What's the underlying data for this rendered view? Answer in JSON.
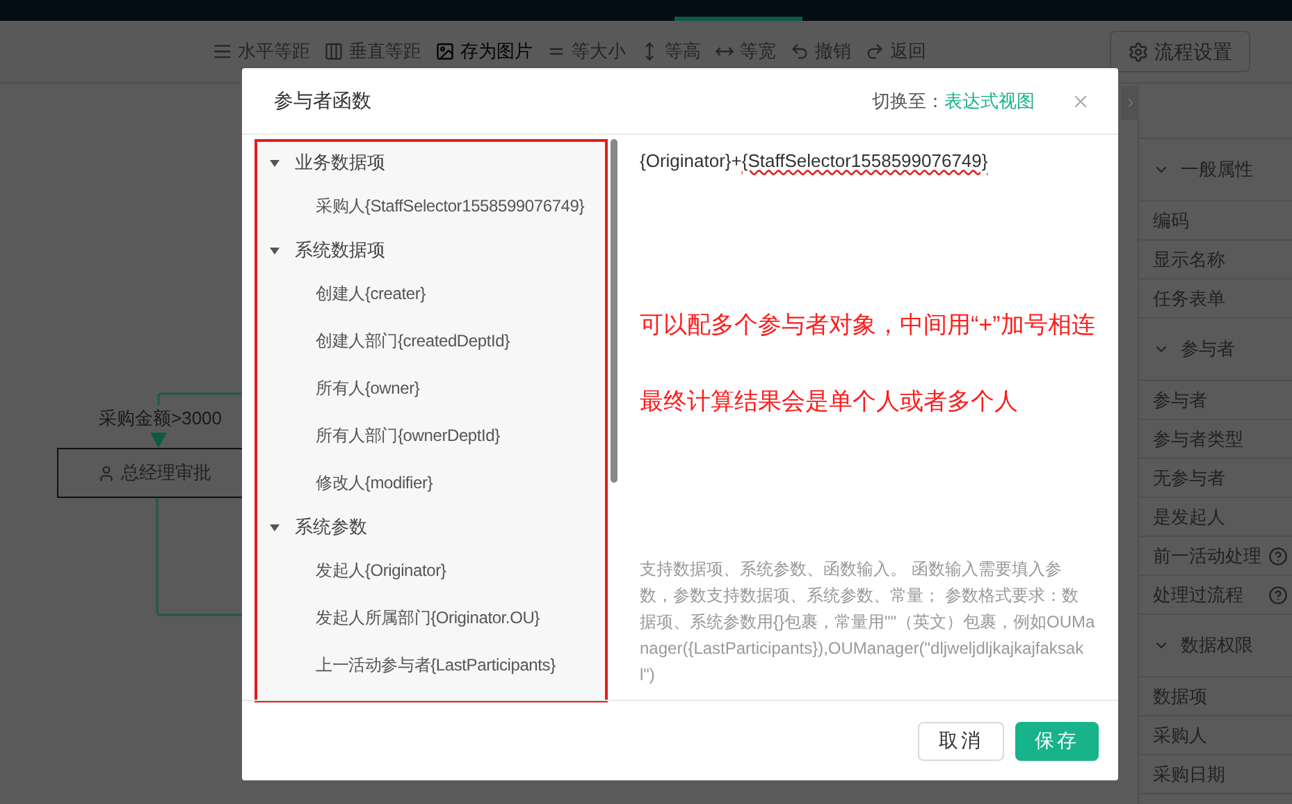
{
  "toolbar": {
    "items": [
      {
        "label": "水平等距",
        "disabled": true
      },
      {
        "label": "垂直等距",
        "disabled": true
      },
      {
        "label": "存为图片",
        "disabled": false
      },
      {
        "label": "等大小",
        "disabled": true
      },
      {
        "label": "等高",
        "disabled": true
      },
      {
        "label": "等宽",
        "disabled": true
      },
      {
        "label": "撤销",
        "disabled": true
      },
      {
        "label": "返回",
        "disabled": true
      }
    ],
    "settings_button": "流程设置"
  },
  "canvas": {
    "edge_label": "采购金额>3000",
    "node_label": "总经理审批"
  },
  "properties": {
    "sections": [
      {
        "title": "一般属性",
        "expanded": true,
        "items": [
          {
            "label": "编码",
            "help": false
          },
          {
            "label": "显示名称",
            "help": false
          },
          {
            "label": "任务表单",
            "help": false
          }
        ]
      },
      {
        "title": "参与者",
        "expanded": true,
        "items": [
          {
            "label": "参与者",
            "help": false
          },
          {
            "label": "参与者类型",
            "help": false
          },
          {
            "label": "无参与者",
            "help": false
          },
          {
            "label": "是发起人",
            "help": false
          },
          {
            "label": "前一活动处理",
            "help": true
          },
          {
            "label": "处理过流程",
            "help": true
          }
        ]
      },
      {
        "title": "数据权限",
        "expanded": true,
        "items": [
          {
            "label": "数据项",
            "help": false
          },
          {
            "label": "采购人",
            "help": false
          },
          {
            "label": "采购日期",
            "help": false
          }
        ]
      }
    ]
  },
  "dialog": {
    "title": "参与者函数",
    "switch_label": "切换至：",
    "switch_link": "表达式视图",
    "tree": [
      {
        "label": "业务数据项",
        "expanded": true,
        "children": [
          {
            "label": "采购人{StaffSelector1558599076749}"
          }
        ]
      },
      {
        "label": "系统数据项",
        "expanded": true,
        "children": [
          {
            "label": "创建人{creater}"
          },
          {
            "label": "创建人部门{createdDeptId}"
          },
          {
            "label": "所有人{owner}"
          },
          {
            "label": "所有人部门{ownerDeptId}"
          },
          {
            "label": "修改人{modifier}"
          }
        ]
      },
      {
        "label": "系统参数",
        "expanded": true,
        "children": [
          {
            "label": "发起人{Originator}"
          },
          {
            "label": "发起人所属部门{Originator.OU}"
          },
          {
            "label": "上一活动参与者{LastParticipants}"
          }
        ]
      }
    ],
    "expression": {
      "text": "{Originator}+",
      "misspelled": "{StaffSelector1558599076749}"
    },
    "annotations": [
      "可以配多个参与者对象，中间用“+”加号相连",
      "最终计算结果会是单个人或者多个人"
    ],
    "hint": "支持数据项、系统参数、函数输入。 函数输入需要填入参数，参数支持数据项、系统参数、常量； 参数格式要求：数据项、系统参数用{}包裹，常量用\"\"（英文）包裹，例如OUManager({LastParticipants}),OUManager(\"dljweljdljkajkajfaksakl\")",
    "buttons": [
      {
        "label": "取消",
        "kind": "secondary"
      },
      {
        "label": "保存",
        "kind": "primary"
      }
    ]
  }
}
